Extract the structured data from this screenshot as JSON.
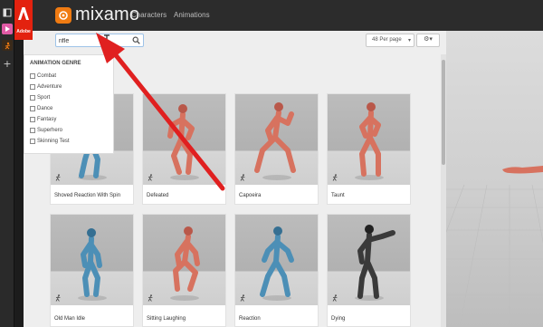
{
  "brand": {
    "adobe": "Adobe",
    "app": "mixamo"
  },
  "nav": {
    "characters": "Characters",
    "animations": "Animations"
  },
  "search": {
    "value": "rifle"
  },
  "toolbar": {
    "per_page": "48 Per page",
    "settings": "⚙▾"
  },
  "genre": {
    "title": "ANIMATION GENRE",
    "items": [
      "Combat",
      "Adventure",
      "Sport",
      "Dance",
      "Fantasy",
      "Superhero",
      "Skinning Test"
    ]
  },
  "cards": [
    {
      "name": "Shoved Reaction With Spin",
      "figure": "blue"
    },
    {
      "name": "Defeated",
      "figure": "red"
    },
    {
      "name": "Capoeira",
      "figure": "red"
    },
    {
      "name": "Taunt",
      "figure": "red"
    },
    {
      "name": "Old Man Idle",
      "figure": "blue"
    },
    {
      "name": "Sitting Laughing",
      "figure": "red"
    },
    {
      "name": "Reaction",
      "figure": "blue"
    },
    {
      "name": "Dying",
      "figure": "dark"
    }
  ],
  "colors": {
    "accent": "#e3220f",
    "mixamo": "#f07b12",
    "figure_red": "#d7725f",
    "figure_blue": "#4c8fb6",
    "arrow": "#e02020"
  }
}
